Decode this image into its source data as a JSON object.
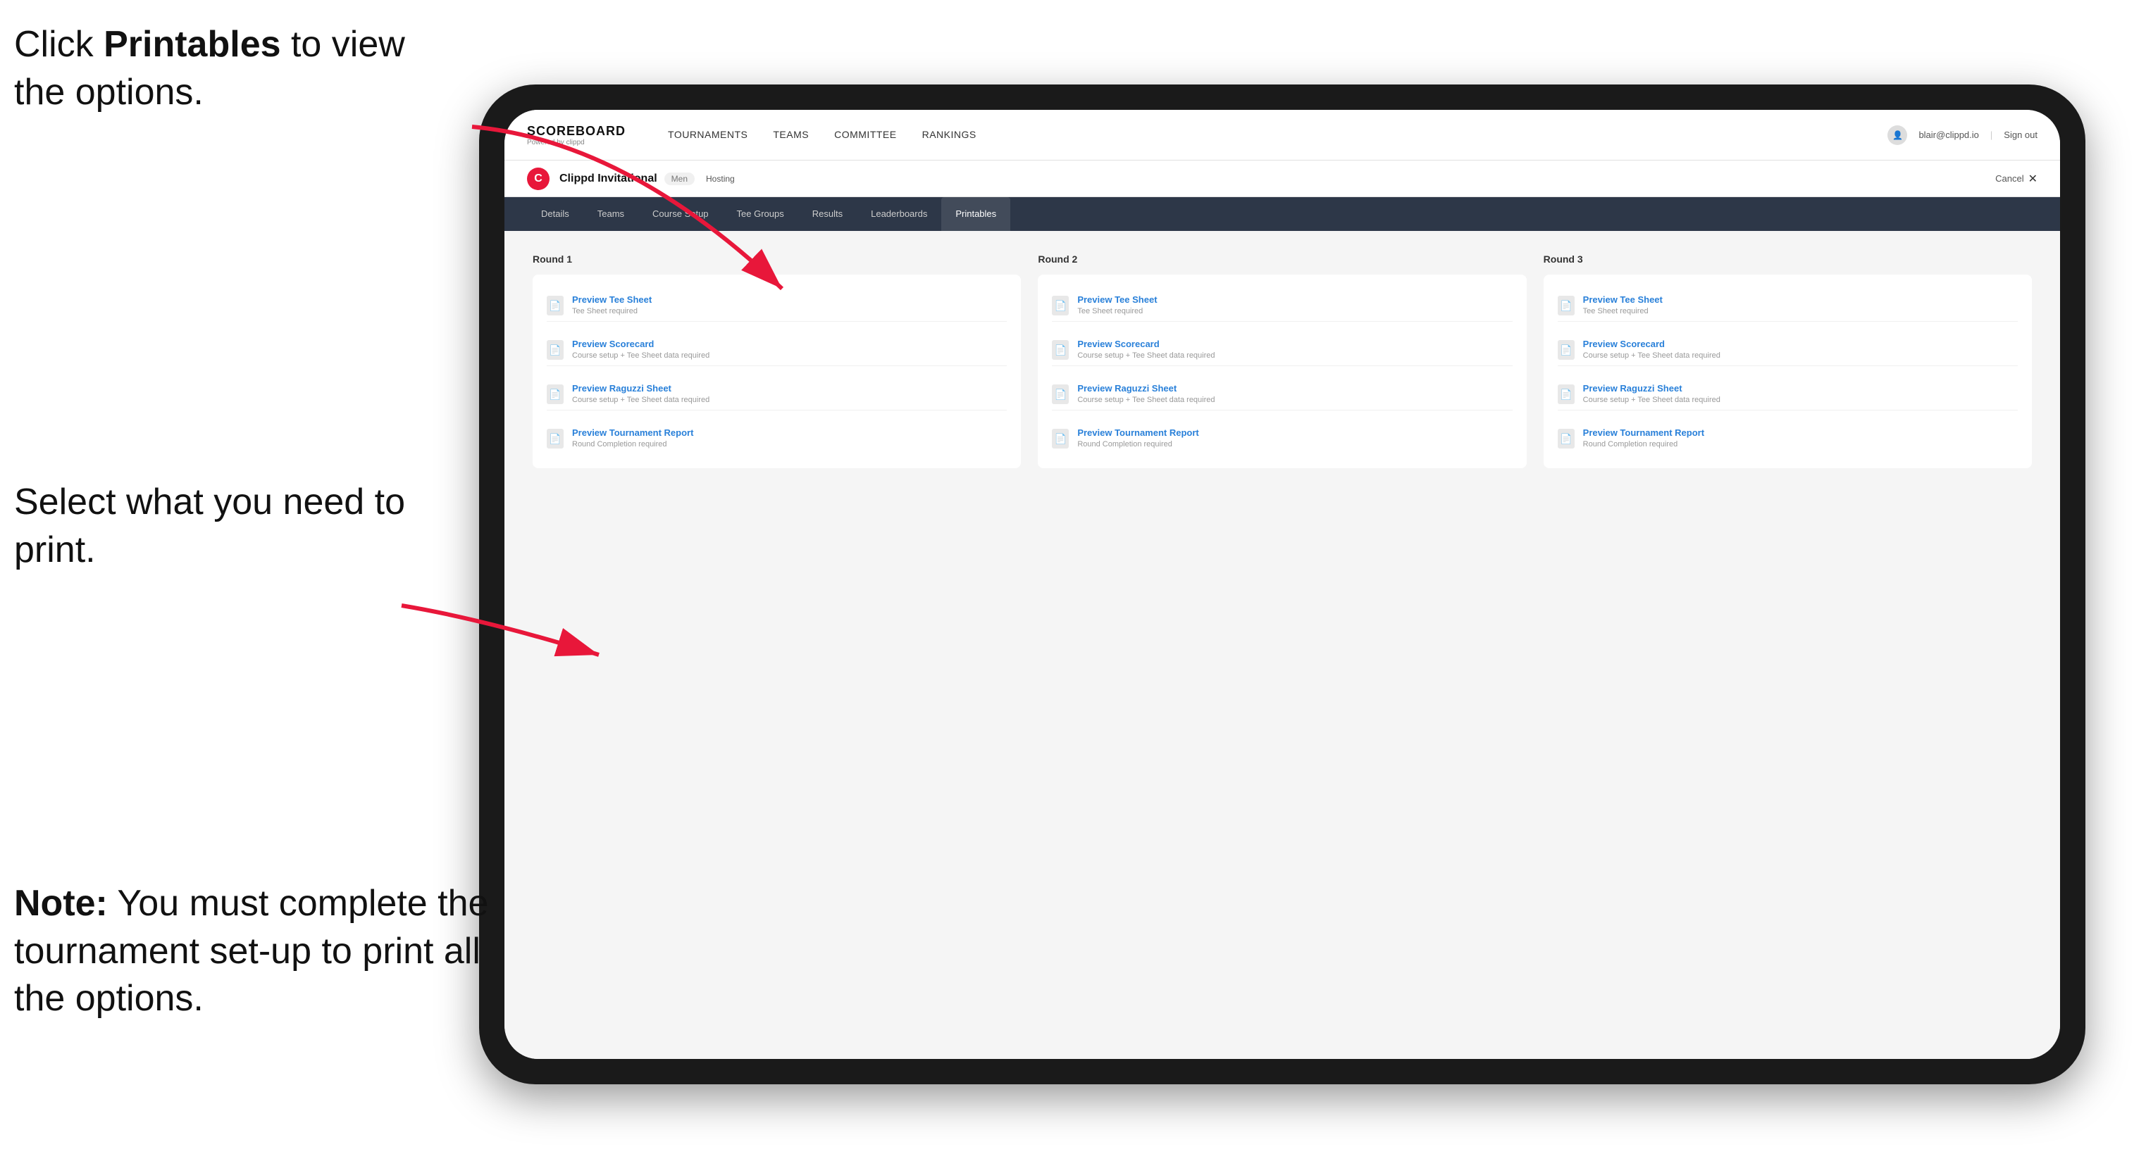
{
  "annotations": {
    "top": {
      "prefix": "Click ",
      "bold": "Printables",
      "suffix": " to view the options."
    },
    "middle": "Select what you need to print.",
    "bottom": {
      "bold": "Note:",
      "suffix": " You must complete the tournament set-up to print all the options."
    }
  },
  "topNav": {
    "brand": {
      "title": "SCOREBOARD",
      "sub": "Powered by clippd"
    },
    "links": [
      "TOURNAMENTS",
      "TEAMS",
      "COMMITTEE",
      "RANKINGS"
    ],
    "user": {
      "email": "blair@clippd.io",
      "separator": "|",
      "signOut": "Sign out"
    }
  },
  "tournamentBar": {
    "logo": "C",
    "name": "Clippd Invitational",
    "badge": "Men",
    "hosting": "Hosting",
    "cancel": "Cancel"
  },
  "subNav": {
    "tabs": [
      "Details",
      "Teams",
      "Course Setup",
      "Tee Groups",
      "Results",
      "Leaderboards",
      "Printables"
    ],
    "activeTab": "Printables"
  },
  "rounds": [
    {
      "title": "Round 1",
      "items": [
        {
          "title": "Preview Tee Sheet",
          "subtitle": "Tee Sheet required"
        },
        {
          "title": "Preview Scorecard",
          "subtitle": "Course setup + Tee Sheet data required"
        },
        {
          "title": "Preview Raguzzi Sheet",
          "subtitle": "Course setup + Tee Sheet data required"
        },
        {
          "title": "Preview Tournament Report",
          "subtitle": "Round Completion required"
        }
      ]
    },
    {
      "title": "Round 2",
      "items": [
        {
          "title": "Preview Tee Sheet",
          "subtitle": "Tee Sheet required"
        },
        {
          "title": "Preview Scorecard",
          "subtitle": "Course setup + Tee Sheet data required"
        },
        {
          "title": "Preview Raguzzi Sheet",
          "subtitle": "Course setup + Tee Sheet data required"
        },
        {
          "title": "Preview Tournament Report",
          "subtitle": "Round Completion required"
        }
      ]
    },
    {
      "title": "Round 3",
      "items": [
        {
          "title": "Preview Tee Sheet",
          "subtitle": "Tee Sheet required"
        },
        {
          "title": "Preview Scorecard",
          "subtitle": "Course setup + Tee Sheet data required"
        },
        {
          "title": "Preview Raguzzi Sheet",
          "subtitle": "Course setup + Tee Sheet data required"
        },
        {
          "title": "Preview Tournament Report",
          "subtitle": "Round Completion required"
        }
      ]
    }
  ]
}
